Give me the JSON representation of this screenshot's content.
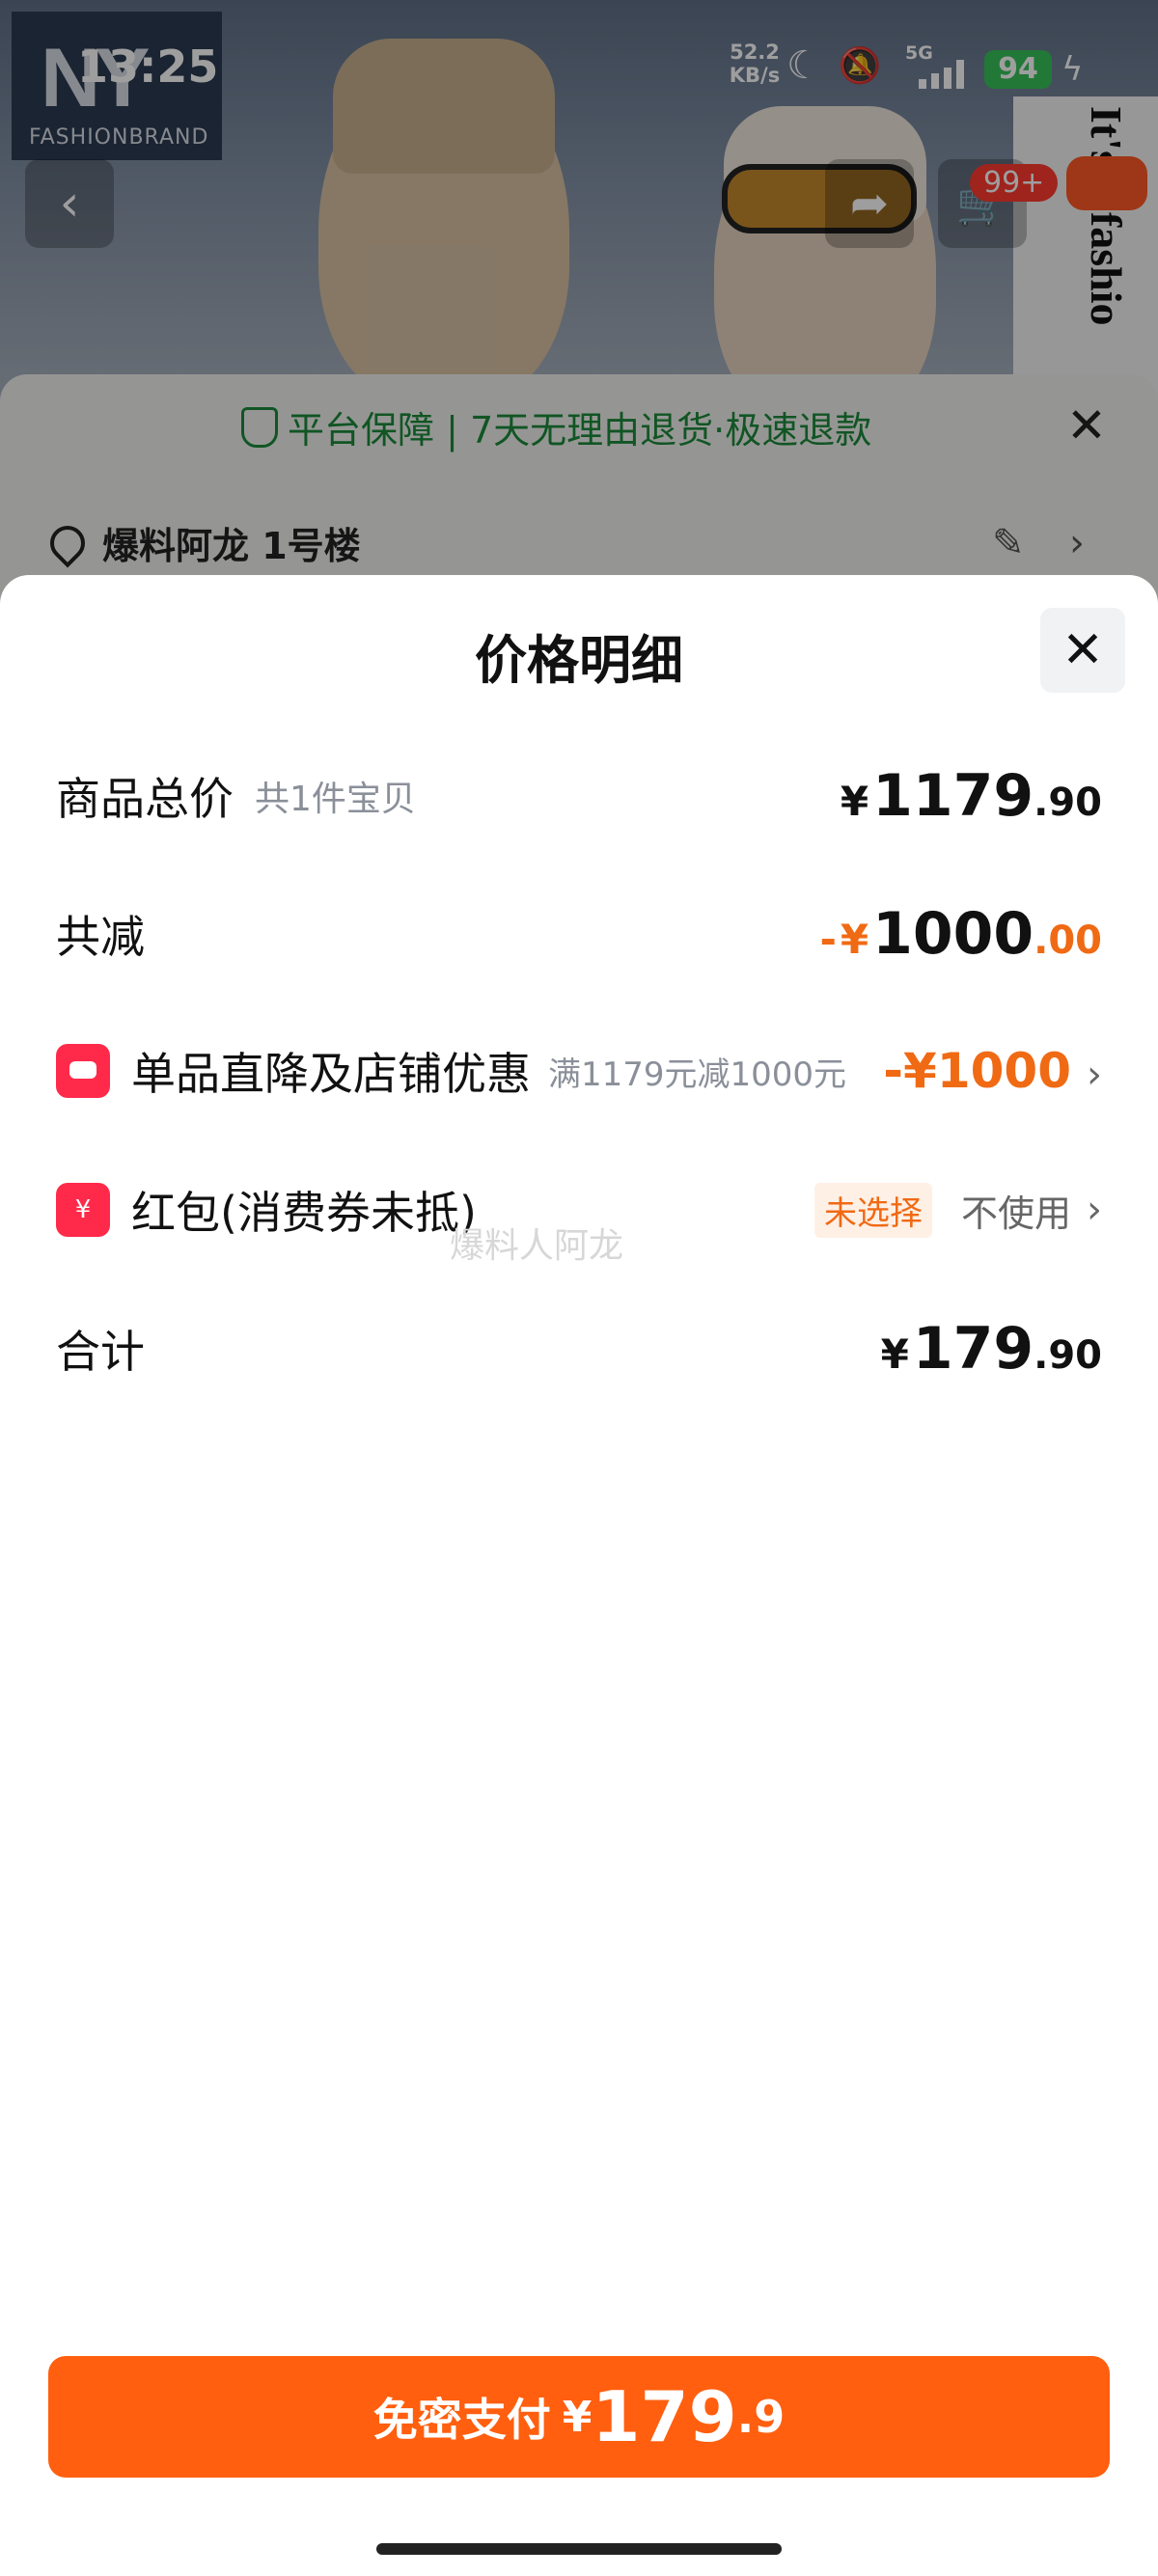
{
  "status_bar": {
    "time": "13:25",
    "net_speed_value": "52.2",
    "net_speed_unit": "KB/s",
    "network": "5G",
    "battery": "94",
    "icons": [
      "moon-icon",
      "mute-icon",
      "signal-icon",
      "charging-icon"
    ]
  },
  "brand": {
    "logo_mark": "NY",
    "name": "FASHIONBRAND",
    "poster_text": "It's a fashio"
  },
  "header": {
    "cart_badge": "99+"
  },
  "background_sheet": {
    "guarantee_text": "平台保障 | 7天无理由退货·极速退款",
    "address": "爆料阿龙 1号楼"
  },
  "modal": {
    "title": "价格明细",
    "rows": {
      "total_goods": {
        "label": "商品总价",
        "sub": "共1件宝贝",
        "currency": "¥",
        "integer": "1179",
        "decimal": ".90"
      },
      "total_discount": {
        "label": "共减",
        "prefix": "-",
        "currency": "¥",
        "integer": "1000",
        "decimal": ".00"
      },
      "shop_discount": {
        "label": "单品直降及店铺优惠",
        "sub": "满1179元减1000元",
        "value": "-¥1000"
      },
      "red_packet": {
        "label": "红包(消费券未抵)",
        "icon_glyph": "¥",
        "tag": "未选择",
        "value": "不使用"
      },
      "sum": {
        "label": "合计",
        "currency": "¥",
        "integer": "179",
        "decimal": ".90"
      }
    },
    "watermark": "爆料人阿龙"
  },
  "pay_button": {
    "label": "免密支付",
    "currency": "¥",
    "integer": "179",
    "decimal": ".9"
  },
  "colors": {
    "accent": "#ff5f0f",
    "discount_text": "#f06a14",
    "guarantee_green": "#1c8a3a",
    "icon_red": "#ff2a4a"
  }
}
